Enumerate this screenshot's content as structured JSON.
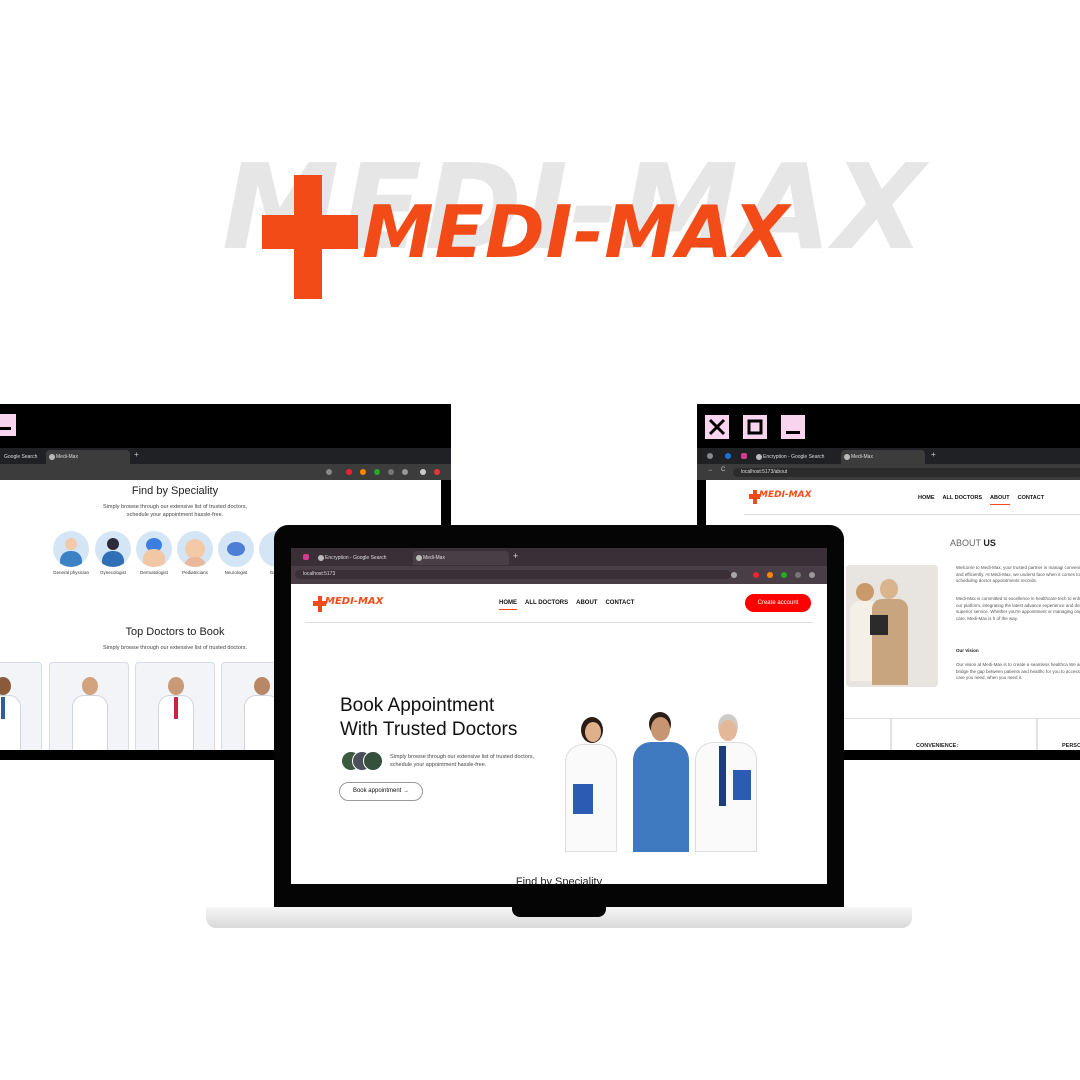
{
  "brand": {
    "name": "MEDI-MAX",
    "bg_name": "MEDI-MAX",
    "color": "#f24b17"
  },
  "left_window": {
    "tabs": [
      {
        "label": "Google Search"
      },
      {
        "label": "Medi-Max"
      }
    ],
    "specialities": {
      "title": "Find by Speciality",
      "subtitle_line1": "Simply browse through our extensive list of trusted doctors,",
      "subtitle_line2": "schedule your appointment hassle-free.",
      "items": [
        {
          "label": "General physician",
          "icon": "doctor-avatar-icon"
        },
        {
          "label": "Gynecologist",
          "icon": "gynecologist-avatar-icon"
        },
        {
          "label": "Dermatologist",
          "icon": "dermatologist-avatar-icon"
        },
        {
          "label": "Pediatricians",
          "icon": "baby-avatar-icon"
        },
        {
          "label": "Neurologist",
          "icon": "brain-icon"
        },
        {
          "label": "Gastr...",
          "icon": "stomach-icon"
        }
      ]
    },
    "top_doctors": {
      "title": "Top Doctors to Book",
      "subtitle": "Simply browse through our extensive list of trusted doctors."
    }
  },
  "right_window": {
    "tabs": [
      {
        "label": "Encryption - Google Search"
      },
      {
        "label": "Medi-Max"
      }
    ],
    "url": "localhost:5173/about",
    "logo": "MEDI-MAX",
    "nav": [
      "HOME",
      "ALL DOCTORS",
      "ABOUT",
      "CONTACT"
    ],
    "about_title_a": "ABOUT",
    "about_title_b": "US",
    "para1": "Welcome to Medi-Max, your trusted partner in managi conveniently and efficiently. At Medi-Max, we underst face when it comes to scheduling doctor appointments records.",
    "para2": "Medi-Max is committed to excellence in healthcare tech to enhance our platform, integrating the latest advance experience and deliver superior service. Whether you're appointment or managing ongoing care, Medi-Max is h of the way.",
    "vision_title": "Our Vision",
    "para3": "Our vision at Medi-Max is to create a seamless healthca We aim to bridge the gap between patients and healthc for you to access the care you need, when you need it.",
    "cards": [
      "CONVENIENCE:",
      "PERSON"
    ]
  },
  "laptop": {
    "tabs": [
      {
        "label": "Encryption - Google Search"
      },
      {
        "label": "Medi-Max"
      }
    ],
    "url": "localhost:5173",
    "logo": "MEDI-MAX",
    "nav": [
      "HOME",
      "ALL DOCTORS",
      "ABOUT",
      "CONTACT"
    ],
    "create_account": "Create account",
    "hero_line1": "Book Appointment",
    "hero_line2": "With Trusted Doctors",
    "hero_sub_line1": "Simply browse through our extensive list of trusted doctors,",
    "hero_sub_line2": "schedule your appointment hassle-free.",
    "book_button": "Book appointment →",
    "next_section_peek": "Find by Speciality"
  }
}
